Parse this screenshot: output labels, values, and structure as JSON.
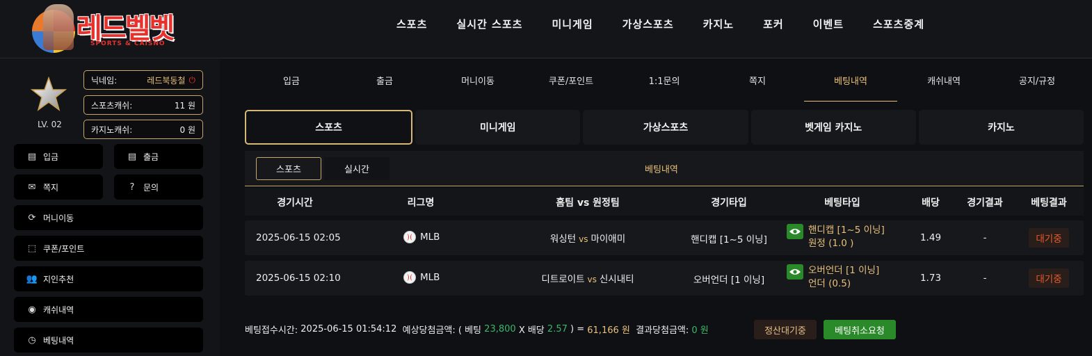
{
  "header": {
    "logo_text": "레드벨벳",
    "logo_sub": "SPORTS & CAISNO",
    "nav": [
      "스포츠",
      "실시간 스포츠",
      "미니게임",
      "가상스포츠",
      "카지노",
      "포커",
      "이벤트",
      "스포츠중계"
    ]
  },
  "profile": {
    "level": "LV. 02",
    "nickname_label": "닉네임:",
    "nickname": "레드북동철",
    "sports_cash_label": "스포츠캐쉬:",
    "sports_cash": "11 원",
    "casino_cash_label": "카지노캐쉬:",
    "casino_cash": "0 원"
  },
  "sidebar": {
    "deposit": "입금",
    "withdraw": "출금",
    "message": "쪽지",
    "inquiry": "문의",
    "money_transfer": "머니이동",
    "coupon_point": "쿠폰/포인트",
    "referral": "지인추천",
    "cash_history": "캐쉬내역",
    "bet_history": "베팅내역"
  },
  "tabs": [
    "입금",
    "출금",
    "머니이동",
    "쿠폰/포인트",
    "1:1문의",
    "쪽지",
    "베팅내역",
    "캐쉬내역",
    "공지/규정"
  ],
  "categories": [
    "스포츠",
    "미니게임",
    "가상스포츠",
    "벳게임 카지노",
    "카지노"
  ],
  "subtabs": {
    "sports": "스포츠",
    "live": "실시간",
    "title": "베팅내역"
  },
  "table": {
    "headers": [
      "경기시간",
      "리그명",
      "홈팀 vs 원정팀",
      "경기타입",
      "베팅타입",
      "배당",
      "경기결과",
      "베팅결과"
    ],
    "vs": "vs",
    "rows": [
      {
        "time": "2025-06-15 02:05",
        "league": "MLB",
        "home": "워싱턴",
        "away": "마이애미",
        "game_type": "핸디캡 [1~5 이닝]",
        "bet_line1": "핸디캡 [1~5 이닝]",
        "bet_line2": "원정 (1.0 )",
        "odds": "1.49",
        "result": "-",
        "bet_result": "대기중"
      },
      {
        "time": "2025-06-15 02:10",
        "league": "MLB",
        "home": "디트로이트",
        "away": "신시내티",
        "game_type": "오버언더 [1 이닝]",
        "bet_line1": "오버언더 [1 이닝]",
        "bet_line2": "언더 (0.5)",
        "odds": "1.73",
        "result": "-",
        "bet_result": "대기중"
      }
    ]
  },
  "footer": {
    "received_label": "베팅접수시간:",
    "received_time": "2025-06-15 01:54:12",
    "expected_label": "예상당첨금액: ( 베팅",
    "bet_amount": "23,800",
    "times_odds": "X 배당",
    "total_odds": "2.57",
    "equals": ") =",
    "expected_amount": "61,166 원",
    "result_label": "결과당첨금액:",
    "result_amount": "0 원",
    "wait_button": "정산대기중",
    "cancel_button": "베팅취소요청"
  }
}
